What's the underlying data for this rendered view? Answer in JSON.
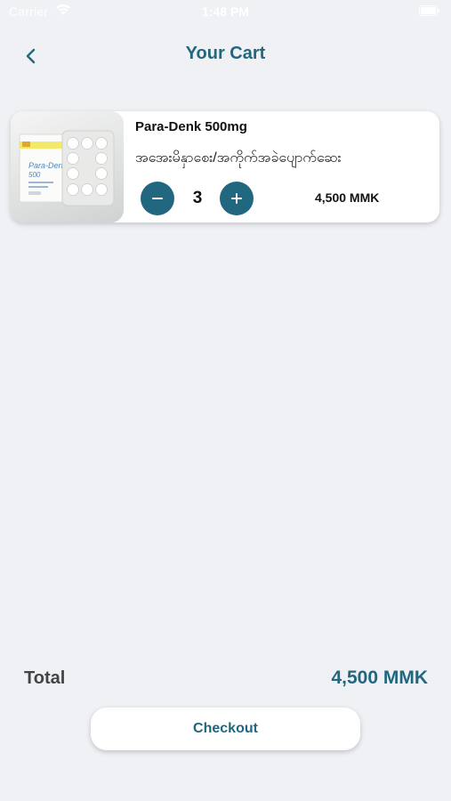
{
  "status_bar": {
    "carrier": "Carrier",
    "time": "1:48 PM"
  },
  "nav": {
    "title": "Your Cart",
    "back_icon": "chevron-left-icon"
  },
  "cart": {
    "items": [
      {
        "name": "Para-Denk 500mg",
        "description": "အအေးမိနှာစေး/အကိုက်အခဲပျောက်ဆေး",
        "quantity": "3",
        "price": "4,500 MMK",
        "image_text": {
          "brand": "Para-Denk",
          "strength": "500"
        }
      }
    ]
  },
  "summary": {
    "total_label": "Total",
    "total_value": "4,500 MMK"
  },
  "actions": {
    "checkout_label": "Checkout"
  },
  "colors": {
    "accent": "#20677f",
    "background": "#eff1f5",
    "card": "#ffffff"
  }
}
